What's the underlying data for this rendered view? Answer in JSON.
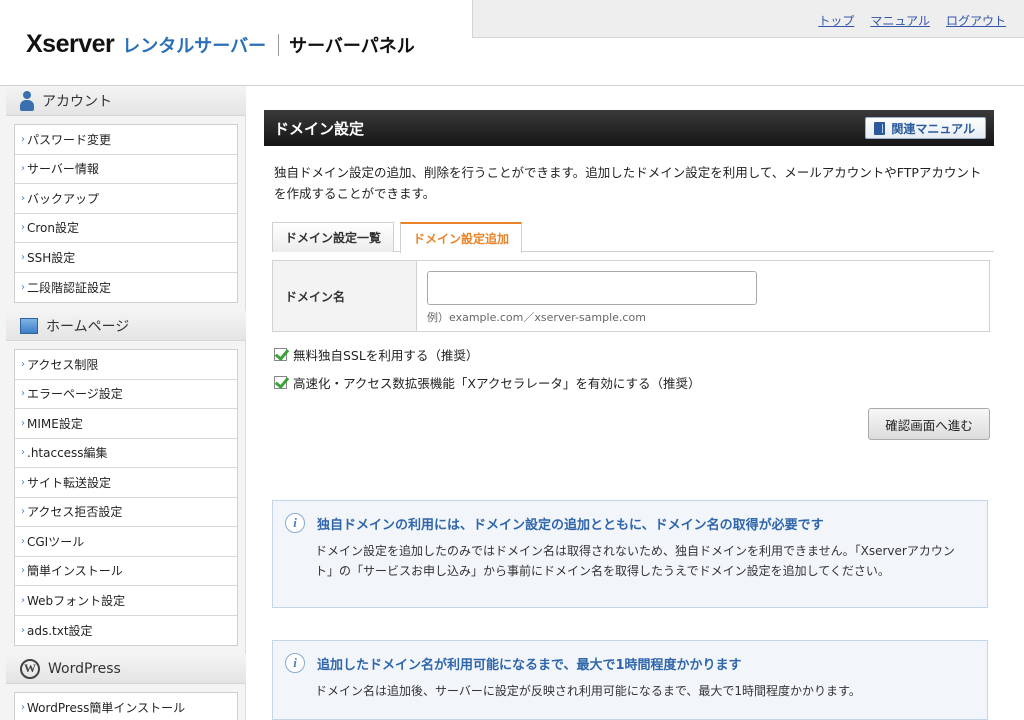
{
  "header": {
    "logo_brand": "Xserver",
    "logo_rental": "レンタルサーバー",
    "logo_panel": "サーバーパネル",
    "links": [
      "トップ",
      "マニュアル",
      "ログアウト"
    ]
  },
  "sidebar": {
    "sections": [
      {
        "title": "アカウント",
        "icon": "person-icon",
        "items": [
          "パスワード変更",
          "サーバー情報",
          "バックアップ",
          "Cron設定",
          "SSH設定",
          "二段階認証設定"
        ]
      },
      {
        "title": "ホームページ",
        "icon": "page-icon",
        "items": [
          "アクセス制限",
          "エラーページ設定",
          "MIME設定",
          ".htaccess編集",
          "サイト転送設定",
          "アクセス拒否設定",
          "CGIツール",
          "簡単インストール",
          "Webフォント設定",
          "ads.txt設定"
        ]
      },
      {
        "title": "WordPress",
        "icon": "wordpress-icon",
        "items": [
          "WordPress簡単インストール"
        ]
      }
    ]
  },
  "main": {
    "title": "ドメイン設定",
    "manual_button": "関連マニュアル",
    "description": "独自ドメイン設定の追加、削除を行うことができます。追加したドメイン設定を利用して、メールアカウントやFTPアカウントを作成することができます。",
    "tabs": [
      {
        "label": "ドメイン設定一覧",
        "active": false
      },
      {
        "label": "ドメイン設定追加",
        "active": true
      }
    ],
    "form": {
      "domain_label": "ドメイン名",
      "domain_value": "",
      "domain_hint": "例）example.com／xserver-sample.com"
    },
    "checkboxes": [
      {
        "label": "無料独自SSLを利用する（推奨）",
        "checked": true
      },
      {
        "label": "高速化・アクセス数拡張機能「Xアクセラレータ」を有効にする（推奨）",
        "checked": true
      }
    ],
    "confirm_button": "確認画面へ進む",
    "info_boxes": [
      {
        "title": "独自ドメインの利用には、ドメイン設定の追加とともに、ドメイン名の取得が必要です",
        "body": "ドメイン設定を追加したのみではドメイン名は取得されないため、独自ドメインを利用できません。「Xserverアカウント」の「サービスお申し込み」から事前にドメイン名を取得したうえでドメイン設定を追加してください。"
      },
      {
        "title": "追加したドメイン名が利用可能になるまで、最大で1時間程度かかります",
        "body": "ドメイン名は追加後、サーバーに設定が反映され利用可能になるまで、最大で1時間程度かかります。"
      }
    ]
  },
  "colors": {
    "accent_orange": "#e8832a",
    "link_blue": "#3355aa",
    "info_blue": "#2f66aa",
    "check_green": "#3aa33a"
  }
}
